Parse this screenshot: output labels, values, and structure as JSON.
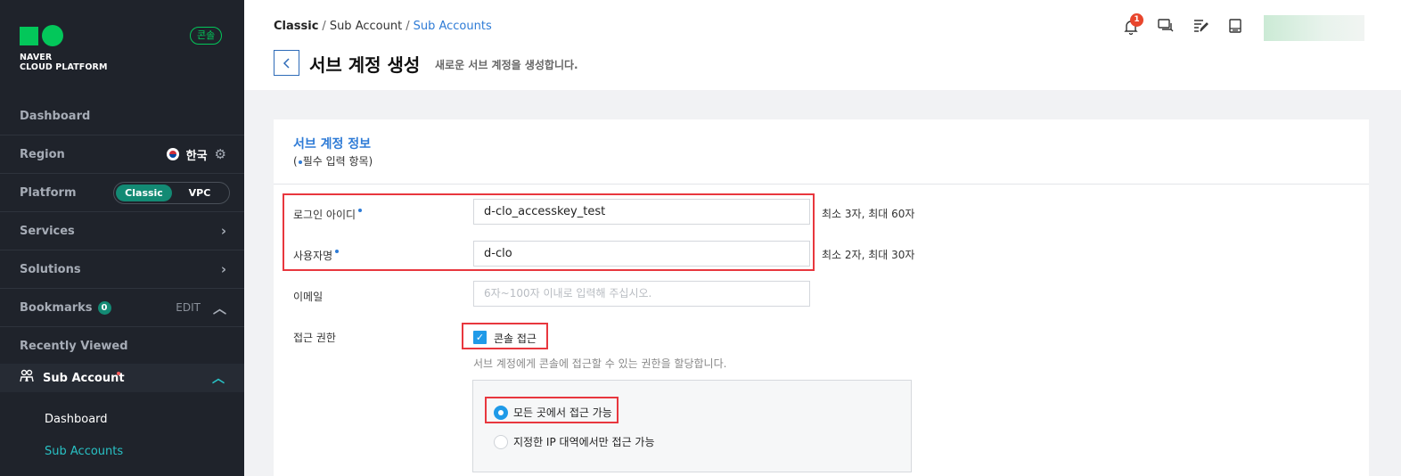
{
  "sidebar": {
    "logo_text": "NAVER\nCLOUD PLATFORM",
    "console_badge": "콘솔",
    "dashboard": "Dashboard",
    "region_label": "Region",
    "region_value": "한국",
    "platform_label": "Platform",
    "platform_options": [
      "Classic",
      "VPC"
    ],
    "services": "Services",
    "solutions": "Solutions",
    "bookmarks": "Bookmarks",
    "bookmarks_count": "0",
    "bookmarks_edit": "EDIT",
    "recently_viewed": "Recently Viewed",
    "sub_account": "Sub Account",
    "sub_items": [
      "Dashboard",
      "Sub Accounts"
    ]
  },
  "header": {
    "breadcrumb": [
      "Classic",
      "Sub Account",
      "Sub Accounts"
    ],
    "title": "서브 계정 생성",
    "subtitle": "새로운 서브 계정을 생성합니다.",
    "notification_count": "1"
  },
  "form": {
    "section_title": "서브 계정 정보",
    "required_prefix": "(",
    "required_note": "필수 입력 항목)",
    "login_id_label": "로그인 아이디",
    "login_id_value": "d-clo_accesskey_test",
    "login_id_hint": "최소 3자, 최대 60자",
    "username_label": "사용자명",
    "username_value": "d-clo",
    "username_hint": "최소 2자, 최대 30자",
    "email_label": "이메일",
    "email_placeholder": "6자~100자 이내로 입력해 주십시오.",
    "access_label": "접근 권한",
    "console_access_label": "콘솔 접근",
    "console_access_desc": "서브 계정에게 콘솔에 접근할 수 있는 권한을 할당합니다.",
    "radio_all": "모든 곳에서 접근 가능",
    "radio_ip": "지정한 IP 대역에서만 접근 가능"
  },
  "colors": {
    "sidebar_bg": "#1f232b",
    "accent_green": "#03c75a",
    "accent_blue": "#2e7bd6",
    "highlight_red": "#e8373e"
  }
}
